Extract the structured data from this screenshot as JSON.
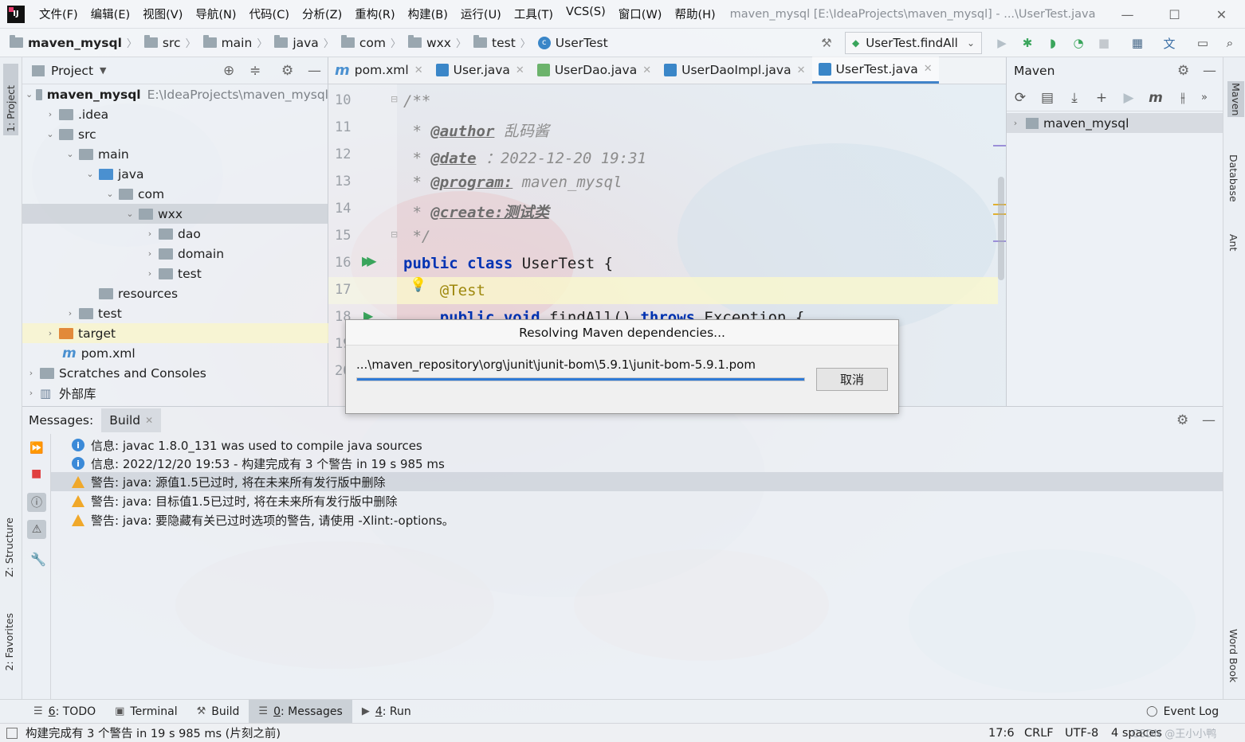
{
  "window": {
    "menu": [
      "文件(F)",
      "编辑(E)",
      "视图(V)",
      "导航(N)",
      "代码(C)",
      "分析(Z)",
      "重构(R)",
      "构建(B)",
      "运行(U)",
      "工具(T)",
      "VCS(S)",
      "窗口(W)",
      "帮助(H)"
    ],
    "title": "maven_mysql [E:\\IdeaProjects\\maven_mysql] - ...\\UserTest.java"
  },
  "breadcrumb": [
    "maven_mysql",
    "src",
    "main",
    "java",
    "com",
    "wxx",
    "test",
    "UserTest"
  ],
  "run_config": "UserTest.findAll",
  "left_stripe": {
    "project": "1: Project",
    "structure": "Z: Structure",
    "favorites": "2: Favorites"
  },
  "right_stripe": {
    "maven": "Maven",
    "database": "Database",
    "ant": "Ant",
    "wordbook": "Word Book"
  },
  "project_panel": {
    "title": "Project",
    "tree": [
      {
        "label": "maven_mysql",
        "path": "E:\\IdeaProjects\\maven_mysql"
      },
      {
        "label": ".idea"
      },
      {
        "label": "src"
      },
      {
        "label": "main"
      },
      {
        "label": "java"
      },
      {
        "label": "com"
      },
      {
        "label": "wxx"
      },
      {
        "label": "dao"
      },
      {
        "label": "domain"
      },
      {
        "label": "test"
      },
      {
        "label": "resources"
      },
      {
        "label": "test"
      },
      {
        "label": "target"
      },
      {
        "label": "pom.xml"
      },
      {
        "label": "Scratches and Consoles"
      },
      {
        "label": "外部库"
      }
    ]
  },
  "editor": {
    "tabs": [
      "pom.xml",
      "User.java",
      "UserDao.java",
      "UserDaoImpl.java",
      "UserTest.java"
    ],
    "line_numbers": [
      "10",
      "11",
      "12",
      "13",
      "14",
      "15",
      "16",
      "17",
      "18",
      "19",
      "20"
    ],
    "lines": {
      "l10": "/**",
      "l11_tag": "@author",
      "l11_text": " 乱码酱",
      "l12_tag": "@date",
      "l12_text": " ：2022-12-20 19:31",
      "l13_tag": "@program:",
      "l13_text": " maven_mysql",
      "l14_tag": "@create:测试类",
      "l15": "*/",
      "l16_kw": "public class",
      "l16_text": " UserTest {",
      "l17": "@Test",
      "l18_kw": "public void",
      "l18_mid": " findAll() ",
      "l18_kw2": "throws",
      "l18_end": " Exception {"
    }
  },
  "maven_panel": {
    "title": "Maven",
    "project": "maven_mysql"
  },
  "messages_panel": {
    "label": "Messages:",
    "tab": "Build",
    "items": [
      {
        "type": "info",
        "text": "信息: javac 1.8.0_131 was used to compile java sources"
      },
      {
        "type": "info",
        "text": "信息: 2022/12/20 19:53 - 构建完成有 3 个警告 in 19 s 985 ms"
      },
      {
        "type": "warning",
        "text": "警告: java: 源值1.5已过时, 将在未来所有发行版中删除"
      },
      {
        "type": "warning",
        "text": "警告: java: 目标值1.5已过时, 将在未来所有发行版中删除"
      },
      {
        "type": "warning",
        "text": "警告: java: 要隐藏有关已过时选项的警告, 请使用 -Xlint:-options。"
      }
    ]
  },
  "bottom_tools": [
    {
      "num": "6",
      "label": ": TODO"
    },
    {
      "num": "",
      "label": "Terminal"
    },
    {
      "num": "",
      "label": "Build"
    },
    {
      "num": "0",
      "label": ": Messages"
    },
    {
      "num": "4",
      "label": ": Run"
    }
  ],
  "event_log": "Event Log",
  "status": {
    "message": "构建完成有 3 个警告 in 19 s 985 ms (片刻之前)",
    "position": "17:6",
    "line_sep": "CRLF",
    "encoding": "UTF-8",
    "indent": "4 spaces",
    "watermark": "CSDN @王小小鸭"
  },
  "dialog": {
    "title": "Resolving Maven dependencies...",
    "path": "...\\maven_repository\\org\\junit\\junit-bom\\5.9.1\\junit-bom-5.9.1.pom",
    "progress": 1.0,
    "cancel": "取消"
  },
  "colors": {
    "accent": "#4083c9",
    "keyword": "#0033b3",
    "annotation": "#9e880d",
    "warning": "#f0a82a",
    "info": "#3b8ad8",
    "run": "#3aa55c"
  }
}
